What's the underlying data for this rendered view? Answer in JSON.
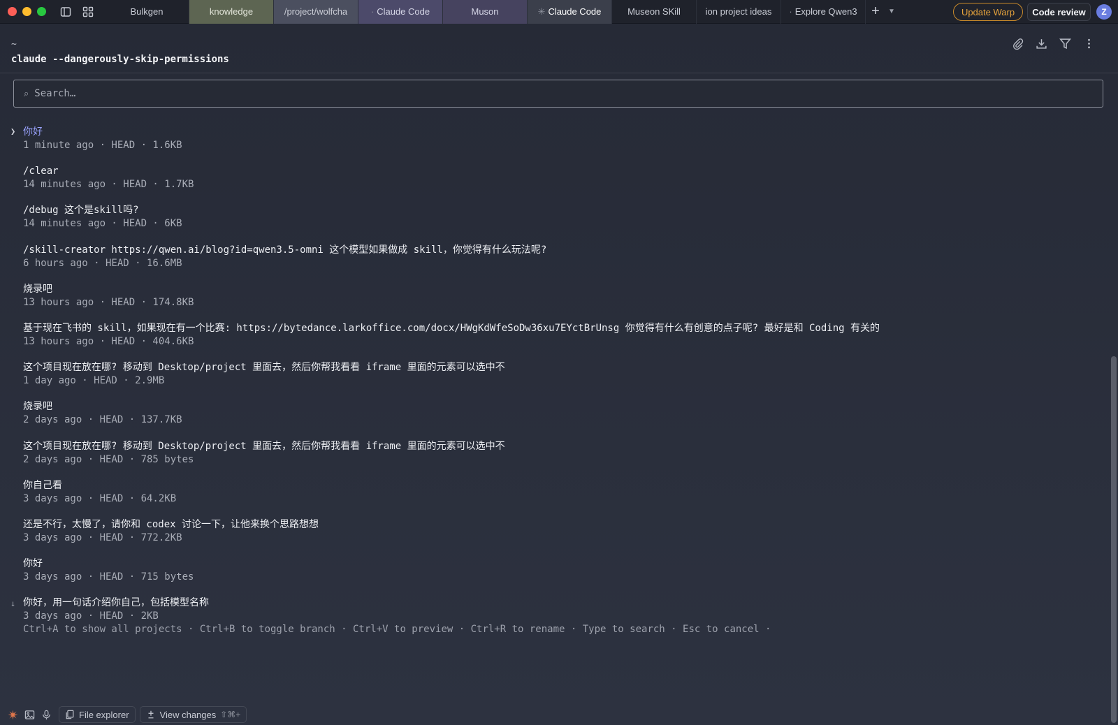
{
  "window": {
    "tabs": [
      {
        "label": "Bulkgen",
        "prefix": ""
      },
      {
        "label": "knowledge",
        "prefix": ""
      },
      {
        "label": "/project/wolfcha",
        "prefix": ""
      },
      {
        "label": "Claude Code",
        "prefix": "·"
      },
      {
        "label": "Muson",
        "prefix": ""
      },
      {
        "label": "Claude Code",
        "prefix": "✳"
      },
      {
        "label": "Museon SKill",
        "prefix": ""
      },
      {
        "label": "ion project ideas",
        "prefix": ""
      },
      {
        "label": "Explore Qwen3",
        "prefix": "·"
      }
    ],
    "update_label": "Update Warp",
    "review_label": "Code review",
    "avatar_initial": "Z"
  },
  "session": {
    "cwd": "~",
    "command": "claude --dangerously-skip-permissions"
  },
  "search": {
    "placeholder": "Search…"
  },
  "conversations": [
    {
      "title": "你好",
      "meta": "1 minute ago · HEAD · 1.6KB"
    },
    {
      "title": "/clear",
      "meta": "14 minutes ago · HEAD · 1.7KB"
    },
    {
      "title": "/debug 这个是skill吗?",
      "meta": "14 minutes ago · HEAD · 6KB"
    },
    {
      "title": "/skill-creator https://qwen.ai/blog?id=qwen3.5-omni 这个模型如果做成 skill，你觉得有什么玩法呢?",
      "meta": "6 hours ago · HEAD · 16.6MB"
    },
    {
      "title": "烧录吧",
      "meta": "13 hours ago · HEAD · 174.8KB"
    },
    {
      "title": "基于现在飞书的 skill，如果现在有一个比赛: https://bytedance.larkoffice.com/docx/HWgKdWfeSoDw36xu7EYctBrUnsg 你觉得有什么有创意的点子呢? 最好是和 Coding 有关的",
      "meta": "13 hours ago · HEAD · 404.6KB"
    },
    {
      "title": "这个项目现在放在哪? 移动到 Desktop/project 里面去，然后你帮我看看 iframe 里面的元素可以选中不",
      "meta": "1 day ago · HEAD · 2.9MB"
    },
    {
      "title": "烧录吧",
      "meta": "2 days ago · HEAD · 137.7KB"
    },
    {
      "title": "这个项目现在放在哪? 移动到 Desktop/project 里面去，然后你帮我看看 iframe 里面的元素可以选中不",
      "meta": "2 days ago · HEAD · 785 bytes"
    },
    {
      "title": "你自己看",
      "meta": "3 days ago · HEAD · 64.2KB"
    },
    {
      "title": "还是不行，太慢了，请你和 codex 讨论一下，让他来换个思路想想",
      "meta": "3 days ago · HEAD · 772.2KB"
    },
    {
      "title": "你好",
      "meta": "3 days ago · HEAD · 715 bytes"
    },
    {
      "title": "你好，用一句话介绍你自己，包括模型名称",
      "meta": "3 days ago · HEAD · 2KB"
    }
  ],
  "selected_marker": "❯",
  "more_marker": "↓",
  "hint": "Ctrl+A to show all projects · Ctrl+B to toggle branch · Ctrl+V to preview · Ctrl+R to rename · Type to search · Esc to cancel ·",
  "footer": {
    "file_explorer_label": "File explorer",
    "view_changes_label": "View changes",
    "view_changes_shortcut": "⇧⌘+"
  },
  "colors": {
    "accent": "#9aa3ff",
    "update": "#e6a33c",
    "claude": "#e0764b"
  }
}
